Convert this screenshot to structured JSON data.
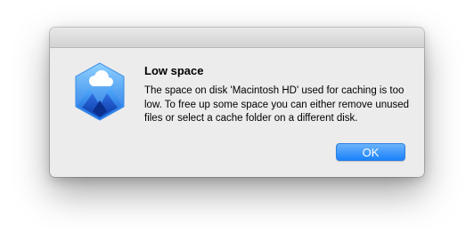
{
  "alert": {
    "title": "Low space",
    "message": "The space on disk 'Macintosh HD' used for caching is too low. To free up some space you can either remove unused files or select a cache folder on a different disk.",
    "ok_label": "OK",
    "icon": "cloud-mountain-app-icon",
    "accent_color": "#1a82fb"
  }
}
